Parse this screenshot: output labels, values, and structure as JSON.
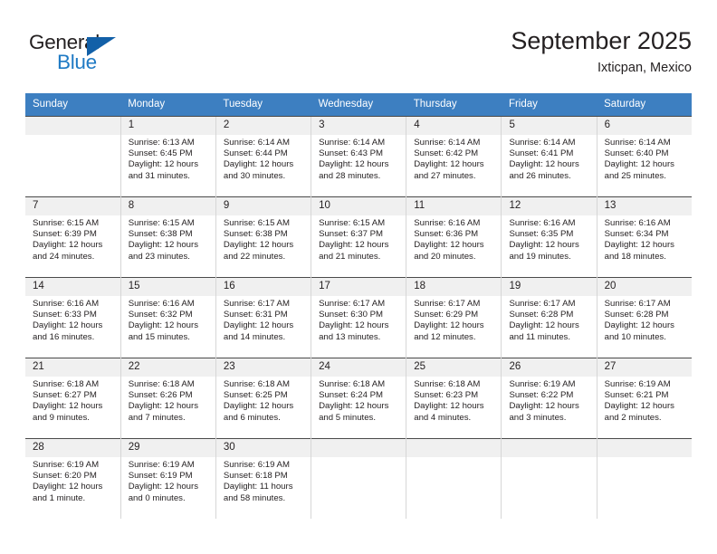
{
  "brand": {
    "name_part1": "General",
    "name_part2": "Blue",
    "triangle_color": "#1260a8",
    "blue_color": "#1f7ac4"
  },
  "header": {
    "title": "September 2025",
    "location": "Ixticpan, Mexico",
    "header_bg_color": "#3d7fc1",
    "daynum_bg_color": "#f0f0f0"
  },
  "weekdays": [
    "Sunday",
    "Monday",
    "Tuesday",
    "Wednesday",
    "Thursday",
    "Friday",
    "Saturday"
  ],
  "weeks": [
    [
      {
        "day": "",
        "sunrise": "",
        "sunset": "",
        "daylight1": "",
        "daylight2": ""
      },
      {
        "day": "1",
        "sunrise": "Sunrise: 6:13 AM",
        "sunset": "Sunset: 6:45 PM",
        "daylight1": "Daylight: 12 hours",
        "daylight2": "and 31 minutes."
      },
      {
        "day": "2",
        "sunrise": "Sunrise: 6:14 AM",
        "sunset": "Sunset: 6:44 PM",
        "daylight1": "Daylight: 12 hours",
        "daylight2": "and 30 minutes."
      },
      {
        "day": "3",
        "sunrise": "Sunrise: 6:14 AM",
        "sunset": "Sunset: 6:43 PM",
        "daylight1": "Daylight: 12 hours",
        "daylight2": "and 28 minutes."
      },
      {
        "day": "4",
        "sunrise": "Sunrise: 6:14 AM",
        "sunset": "Sunset: 6:42 PM",
        "daylight1": "Daylight: 12 hours",
        "daylight2": "and 27 minutes."
      },
      {
        "day": "5",
        "sunrise": "Sunrise: 6:14 AM",
        "sunset": "Sunset: 6:41 PM",
        "daylight1": "Daylight: 12 hours",
        "daylight2": "and 26 minutes."
      },
      {
        "day": "6",
        "sunrise": "Sunrise: 6:14 AM",
        "sunset": "Sunset: 6:40 PM",
        "daylight1": "Daylight: 12 hours",
        "daylight2": "and 25 minutes."
      }
    ],
    [
      {
        "day": "7",
        "sunrise": "Sunrise: 6:15 AM",
        "sunset": "Sunset: 6:39 PM",
        "daylight1": "Daylight: 12 hours",
        "daylight2": "and 24 minutes."
      },
      {
        "day": "8",
        "sunrise": "Sunrise: 6:15 AM",
        "sunset": "Sunset: 6:38 PM",
        "daylight1": "Daylight: 12 hours",
        "daylight2": "and 23 minutes."
      },
      {
        "day": "9",
        "sunrise": "Sunrise: 6:15 AM",
        "sunset": "Sunset: 6:38 PM",
        "daylight1": "Daylight: 12 hours",
        "daylight2": "and 22 minutes."
      },
      {
        "day": "10",
        "sunrise": "Sunrise: 6:15 AM",
        "sunset": "Sunset: 6:37 PM",
        "daylight1": "Daylight: 12 hours",
        "daylight2": "and 21 minutes."
      },
      {
        "day": "11",
        "sunrise": "Sunrise: 6:16 AM",
        "sunset": "Sunset: 6:36 PM",
        "daylight1": "Daylight: 12 hours",
        "daylight2": "and 20 minutes."
      },
      {
        "day": "12",
        "sunrise": "Sunrise: 6:16 AM",
        "sunset": "Sunset: 6:35 PM",
        "daylight1": "Daylight: 12 hours",
        "daylight2": "and 19 minutes."
      },
      {
        "day": "13",
        "sunrise": "Sunrise: 6:16 AM",
        "sunset": "Sunset: 6:34 PM",
        "daylight1": "Daylight: 12 hours",
        "daylight2": "and 18 minutes."
      }
    ],
    [
      {
        "day": "14",
        "sunrise": "Sunrise: 6:16 AM",
        "sunset": "Sunset: 6:33 PM",
        "daylight1": "Daylight: 12 hours",
        "daylight2": "and 16 minutes."
      },
      {
        "day": "15",
        "sunrise": "Sunrise: 6:16 AM",
        "sunset": "Sunset: 6:32 PM",
        "daylight1": "Daylight: 12 hours",
        "daylight2": "and 15 minutes."
      },
      {
        "day": "16",
        "sunrise": "Sunrise: 6:17 AM",
        "sunset": "Sunset: 6:31 PM",
        "daylight1": "Daylight: 12 hours",
        "daylight2": "and 14 minutes."
      },
      {
        "day": "17",
        "sunrise": "Sunrise: 6:17 AM",
        "sunset": "Sunset: 6:30 PM",
        "daylight1": "Daylight: 12 hours",
        "daylight2": "and 13 minutes."
      },
      {
        "day": "18",
        "sunrise": "Sunrise: 6:17 AM",
        "sunset": "Sunset: 6:29 PM",
        "daylight1": "Daylight: 12 hours",
        "daylight2": "and 12 minutes."
      },
      {
        "day": "19",
        "sunrise": "Sunrise: 6:17 AM",
        "sunset": "Sunset: 6:28 PM",
        "daylight1": "Daylight: 12 hours",
        "daylight2": "and 11 minutes."
      },
      {
        "day": "20",
        "sunrise": "Sunrise: 6:17 AM",
        "sunset": "Sunset: 6:28 PM",
        "daylight1": "Daylight: 12 hours",
        "daylight2": "and 10 minutes."
      }
    ],
    [
      {
        "day": "21",
        "sunrise": "Sunrise: 6:18 AM",
        "sunset": "Sunset: 6:27 PM",
        "daylight1": "Daylight: 12 hours",
        "daylight2": "and 9 minutes."
      },
      {
        "day": "22",
        "sunrise": "Sunrise: 6:18 AM",
        "sunset": "Sunset: 6:26 PM",
        "daylight1": "Daylight: 12 hours",
        "daylight2": "and 7 minutes."
      },
      {
        "day": "23",
        "sunrise": "Sunrise: 6:18 AM",
        "sunset": "Sunset: 6:25 PM",
        "daylight1": "Daylight: 12 hours",
        "daylight2": "and 6 minutes."
      },
      {
        "day": "24",
        "sunrise": "Sunrise: 6:18 AM",
        "sunset": "Sunset: 6:24 PM",
        "daylight1": "Daylight: 12 hours",
        "daylight2": "and 5 minutes."
      },
      {
        "day": "25",
        "sunrise": "Sunrise: 6:18 AM",
        "sunset": "Sunset: 6:23 PM",
        "daylight1": "Daylight: 12 hours",
        "daylight2": "and 4 minutes."
      },
      {
        "day": "26",
        "sunrise": "Sunrise: 6:19 AM",
        "sunset": "Sunset: 6:22 PM",
        "daylight1": "Daylight: 12 hours",
        "daylight2": "and 3 minutes."
      },
      {
        "day": "27",
        "sunrise": "Sunrise: 6:19 AM",
        "sunset": "Sunset: 6:21 PM",
        "daylight1": "Daylight: 12 hours",
        "daylight2": "and 2 minutes."
      }
    ],
    [
      {
        "day": "28",
        "sunrise": "Sunrise: 6:19 AM",
        "sunset": "Sunset: 6:20 PM",
        "daylight1": "Daylight: 12 hours",
        "daylight2": "and 1 minute."
      },
      {
        "day": "29",
        "sunrise": "Sunrise: 6:19 AM",
        "sunset": "Sunset: 6:19 PM",
        "daylight1": "Daylight: 12 hours",
        "daylight2": "and 0 minutes."
      },
      {
        "day": "30",
        "sunrise": "Sunrise: 6:19 AM",
        "sunset": "Sunset: 6:18 PM",
        "daylight1": "Daylight: 11 hours",
        "daylight2": "and 58 minutes."
      },
      {
        "day": "",
        "sunrise": "",
        "sunset": "",
        "daylight1": "",
        "daylight2": ""
      },
      {
        "day": "",
        "sunrise": "",
        "sunset": "",
        "daylight1": "",
        "daylight2": ""
      },
      {
        "day": "",
        "sunrise": "",
        "sunset": "",
        "daylight1": "",
        "daylight2": ""
      },
      {
        "day": "",
        "sunrise": "",
        "sunset": "",
        "daylight1": "",
        "daylight2": ""
      }
    ]
  ]
}
